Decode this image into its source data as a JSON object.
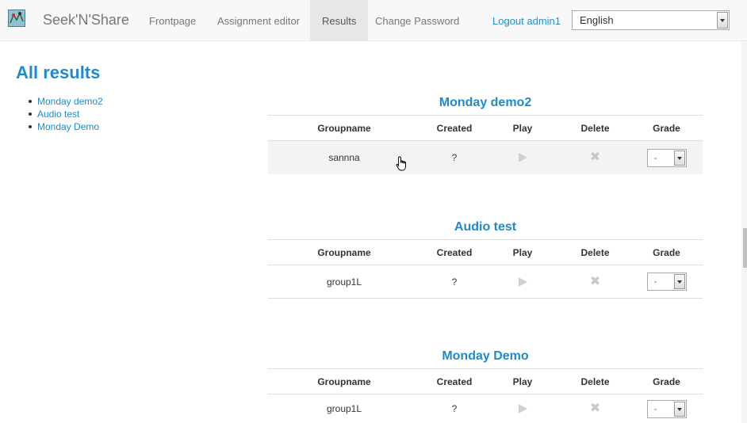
{
  "nav": {
    "brand": "Seek'N'Share",
    "items": [
      "Frontpage",
      "Assignment editor",
      "Results",
      "Change Password"
    ],
    "logout": "Logout admin1",
    "language": "English"
  },
  "sidebar": {
    "title": "All results",
    "links": [
      "Monday demo2",
      "Audio test",
      "Monday Demo"
    ]
  },
  "columns": [
    "Groupname",
    "Created",
    "Play",
    "Delete",
    "Grade"
  ],
  "sections": [
    {
      "title": "Monday demo2",
      "row": {
        "group": "sannna",
        "created": "?",
        "grade": "-"
      }
    },
    {
      "title": "Audio test",
      "row": {
        "group": "group1L",
        "created": "?",
        "grade": "-"
      }
    },
    {
      "title": "Monday Demo",
      "row": {
        "group": "group1L",
        "created": "?",
        "grade": "-"
      }
    }
  ],
  "colors": {
    "accent": "#1e8acd",
    "link": "#1e90d0"
  },
  "icons": {
    "logo": "map-logo-icon",
    "play": "play-icon",
    "delete": "delete-x-icon",
    "dropdown": "chevron-down-icon"
  }
}
